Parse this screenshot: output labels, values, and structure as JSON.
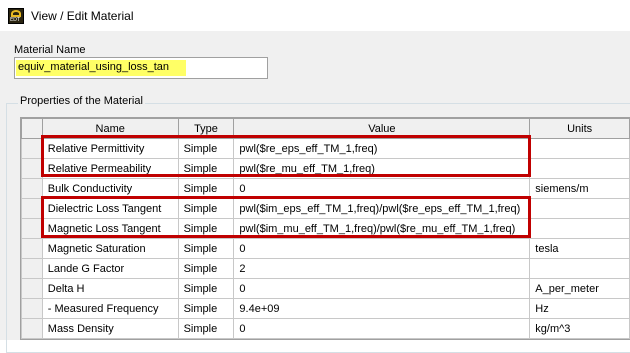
{
  "window": {
    "title": "View / Edit Material",
    "icon": "app-logo-icon"
  },
  "material_name": {
    "label": "Material Name",
    "value": "equiv_material_using_loss_tan"
  },
  "properties": {
    "group_label": "Properties of the Material",
    "columns": [
      "Name",
      "Type",
      "Value",
      "Units"
    ],
    "rows": [
      {
        "name": "Relative Permittivity",
        "type": "Simple",
        "value": "pwl($re_eps_eff_TM_1,freq)",
        "units": ""
      },
      {
        "name": "Relative Permeability",
        "type": "Simple",
        "value": "pwl($re_mu_eff_TM_1,freq)",
        "units": ""
      },
      {
        "name": "Bulk Conductivity",
        "type": "Simple",
        "value": "0",
        "units": "siemens/m"
      },
      {
        "name": "Dielectric Loss Tangent",
        "type": "Simple",
        "value": "pwl($im_eps_eff_TM_1,freq)/pwl($re_eps_eff_TM_1,freq)",
        "units": ""
      },
      {
        "name": "Magnetic Loss Tangent",
        "type": "Simple",
        "value": "pwl($im_mu_eff_TM_1,freq)/pwl($re_mu_eff_TM_1,freq)",
        "units": ""
      },
      {
        "name": "Magnetic Saturation",
        "type": "Simple",
        "value": "0",
        "units": "tesla"
      },
      {
        "name": "Lande G Factor",
        "type": "Simple",
        "value": "2",
        "units": ""
      },
      {
        "name": "Delta H",
        "type": "Simple",
        "value": "0",
        "units": "A_per_meter"
      },
      {
        "name": "-  Measured Frequency",
        "type": "Simple",
        "value": "9.4e+09",
        "units": "Hz"
      },
      {
        "name": "Mass Density",
        "type": "Simple",
        "value": "0",
        "units": "kg/m^3"
      }
    ]
  },
  "highlight_color": "#c00000",
  "name_highlight_color": "#ffff66"
}
